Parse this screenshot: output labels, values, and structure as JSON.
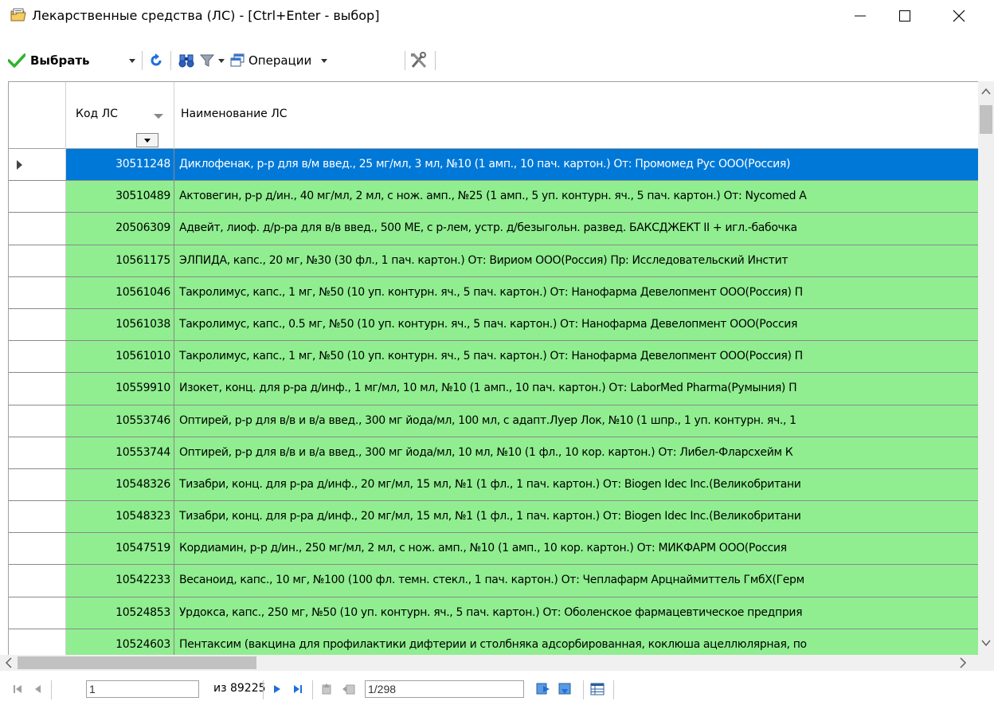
{
  "window": {
    "title": "Лекарственные средства (ЛС) - [Ctrl+Enter - выбор]"
  },
  "toolbar": {
    "select_label": "Выбрать",
    "operations_label": "Операции"
  },
  "grid": {
    "columns": [
      "Код ЛС",
      "Наименование ЛС"
    ],
    "selected_index": 0,
    "rows": [
      {
        "code": "30511248",
        "name": "Диклофенак, р-р для в/м введ., 25 мг/мл, 3 мл, №10 (1 амп., 10 пач. картон.) От: Промомед Рус ООО(Россия)"
      },
      {
        "code": "30510489",
        "name": "Актовегин, р-р д/ин., 40 мг/мл, 2 мл, с нож. амп., №25 (1 амп., 5 уп. контурн. яч., 5 пач. картон.) От: Nycomed A"
      },
      {
        "code": "20506309",
        "name": "Адвейт, лиоф. д/р-ра для в/в введ., 500 МЕ, с р-лем, устр. д/безыгольн. развед. БАКСДЖЕКТ II + игл.-бабочка"
      },
      {
        "code": "10561175",
        "name": "ЭЛПИДА, капс., 20 мг, №30 (30 фл., 1 пач. картон.) От: Вириом ООО(Россия) Пр: Исследовательский Инстит"
      },
      {
        "code": "10561046",
        "name": "Такролимус, капс., 1 мг, №50 (10 уп. контурн. яч., 5 пач. картон.) От: Нанофарма Девелопмент ООО(Россия) П"
      },
      {
        "code": "10561038",
        "name": "Такролимус, капс., 0.5 мг, №50 (10 уп. контурн. яч., 5 пач. картон.) От: Нанофарма Девелопмент ООО(Россия"
      },
      {
        "code": "10561010",
        "name": "Такролимус, капс., 1 мг, №50 (10 уп. контурн. яч., 5 пач. картон.) От: Нанофарма Девелопмент ООО(Россия) П"
      },
      {
        "code": "10559910",
        "name": "Изокет, конц. для р-ра д/инф., 1 мг/мл, 10 мл, №10 (1 амп., 10 пач. картон.) От: LaborMed Pharma(Румыния) П"
      },
      {
        "code": "10553746",
        "name": "Оптирей, р-р для в/в и в/а введ., 300 мг йода/мл, 100 мл, с адапт.Луер Лок, №10 (1 шпр., 1 уп. контурн. яч., 1"
      },
      {
        "code": "10553744",
        "name": "Оптирей, р-р для в/в и в/а введ., 300 мг йода/мл, 10 мл, №10 (1 фл., 10 кор. картон.) От: Либел-Фларсхейм К"
      },
      {
        "code": "10548326",
        "name": "Тизабри, конц. для р-ра д/инф., 20 мг/мл, 15 мл, №1 (1 фл., 1 пач. картон.) От: Biogen Idec Inc.(Великобритани"
      },
      {
        "code": "10548323",
        "name": "Тизабри, конц. для р-ра д/инф., 20 мг/мл, 15 мл, №1 (1 фл., 1 пач. картон.) От: Biogen Idec Inc.(Великобритани"
      },
      {
        "code": "10547519",
        "name": "Кордиамин, р-р д/ин., 250 мг/мл, 2 мл, с нож. амп., №10 (1 амп., 10 кор. картон.) От: МИКФАРМ ООО(Россия"
      },
      {
        "code": "10542233",
        "name": "Весаноид, капс., 10 мг, №100 (100 фл. темн. стекл., 1 пач. картон.) От: Чеплафарм Арцнаймиттель ГмбХ(Герм"
      },
      {
        "code": "10524853",
        "name": "Урдокса, капс., 250 мг, №50 (10 уп. контурн. яч., 5 пач. картон.) От: Оболенское фармацевтическое предприя"
      },
      {
        "code": "10524603",
        "name": "Пентаксим (вакцина для профилактики дифтерии и столбняка адсорбированная, коклюша ацеллюлярная, по"
      }
    ]
  },
  "navigator": {
    "position_value": "1",
    "total_text": "из 89225",
    "page_value": "1/298"
  },
  "colors": {
    "row_bg": "#90ee90",
    "selected_bg": "#0078d7"
  }
}
